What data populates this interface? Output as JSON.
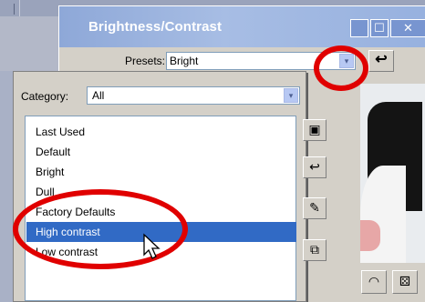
{
  "window": {
    "title": "Brightness/Contrast"
  },
  "titlebar": {
    "minimize_glyph": "",
    "maximize_glyph": "☐",
    "close_glyph": "✕"
  },
  "presets": {
    "label": "Presets:",
    "value": "Bright",
    "arrow_glyph": "▾",
    "reset_glyph": "↩"
  },
  "dropdown": {
    "category_label": "Category:",
    "category_value": "All",
    "category_arrow": "▾",
    "items": [
      {
        "label": "Last Used"
      },
      {
        "label": "Default"
      },
      {
        "label": "Bright"
      },
      {
        "label": "Dull"
      },
      {
        "label": "Factory Defaults"
      },
      {
        "label": "High contrast",
        "selected": true
      },
      {
        "label": "Low contrast"
      }
    ],
    "side_buttons": [
      {
        "icon": "save-icon",
        "glyph": "▣"
      },
      {
        "icon": "reset-icon",
        "glyph": "↩"
      },
      {
        "icon": "edit-presets-icon",
        "glyph": "✎"
      },
      {
        "icon": "copy-icon",
        "glyph": "⧉"
      }
    ]
  },
  "bottom_buttons": [
    {
      "icon": "eye-icon",
      "glyph": "◠"
    },
    {
      "icon": "dice-icon",
      "glyph": "⚄"
    }
  ],
  "colors": {
    "annotation": "#e00000",
    "selection": "#316ac5",
    "titlebar": "#97b1df"
  }
}
